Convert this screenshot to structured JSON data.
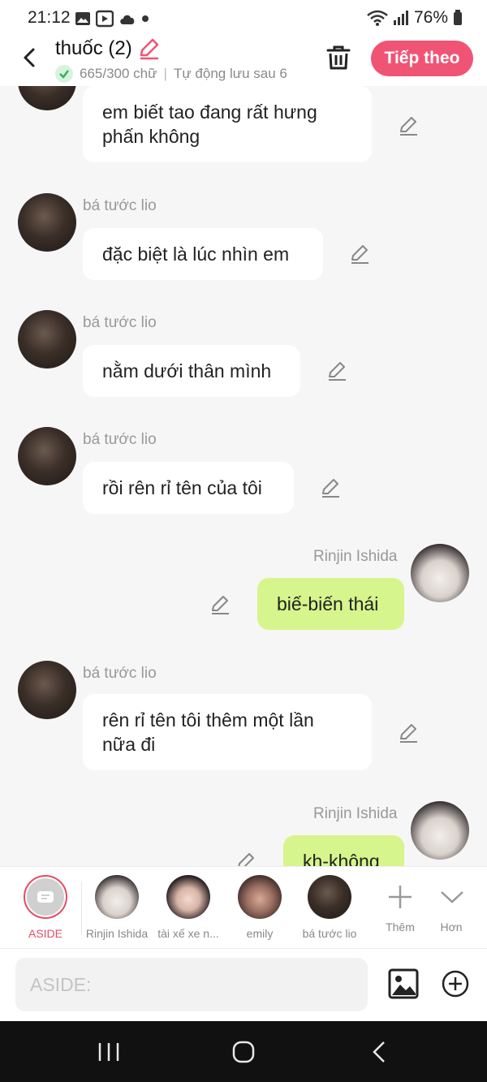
{
  "status": {
    "time": "21:12",
    "battery": "76%"
  },
  "header": {
    "title": "thuốc (2)",
    "word_count": "665/300 chữ",
    "autosave": "Tự động lưu sau 6",
    "next_label": "Tiếp theo"
  },
  "messages": [
    {
      "side": "in",
      "text": "em biết tao đang rất hưng phấn không"
    },
    {
      "side": "in",
      "sender": "bá tước lio",
      "text": "đặc biệt là lúc nhìn em"
    },
    {
      "side": "in",
      "sender": "bá tước lio",
      "text": "nằm dưới thân mình"
    },
    {
      "side": "in",
      "sender": "bá tước lio",
      "text": "rồi rên rỉ tên của tôi"
    },
    {
      "side": "out",
      "sender": "Rinjin Ishida",
      "text": "biế-biến thái"
    },
    {
      "side": "in",
      "sender": "bá tước lio",
      "text": "rên rỉ tên tôi thêm một lần nữa đi"
    },
    {
      "side": "out",
      "sender": "Rinjin Ishida",
      "text": "kh-không"
    }
  ],
  "characters": [
    {
      "label": "ASIDE",
      "color": "#e34d66"
    },
    {
      "label": "Rinjin Ishida"
    },
    {
      "label": "tài xế xe n..."
    },
    {
      "label": "emily"
    },
    {
      "label": "bá tước lio"
    },
    {
      "label": "Thêm"
    },
    {
      "label": "Hơn"
    }
  ],
  "input": {
    "placeholder": "ASIDE:"
  },
  "colors": {
    "accent": "#f05474",
    "out_bubble": "#d6f58c",
    "in_bubble": "#ffffff"
  },
  "icons": [
    "back-icon",
    "edit-icon",
    "check-icon",
    "trash-icon",
    "pencil-icon",
    "plus-icon",
    "chevron-down-icon",
    "image-icon",
    "add-circle-icon"
  ]
}
